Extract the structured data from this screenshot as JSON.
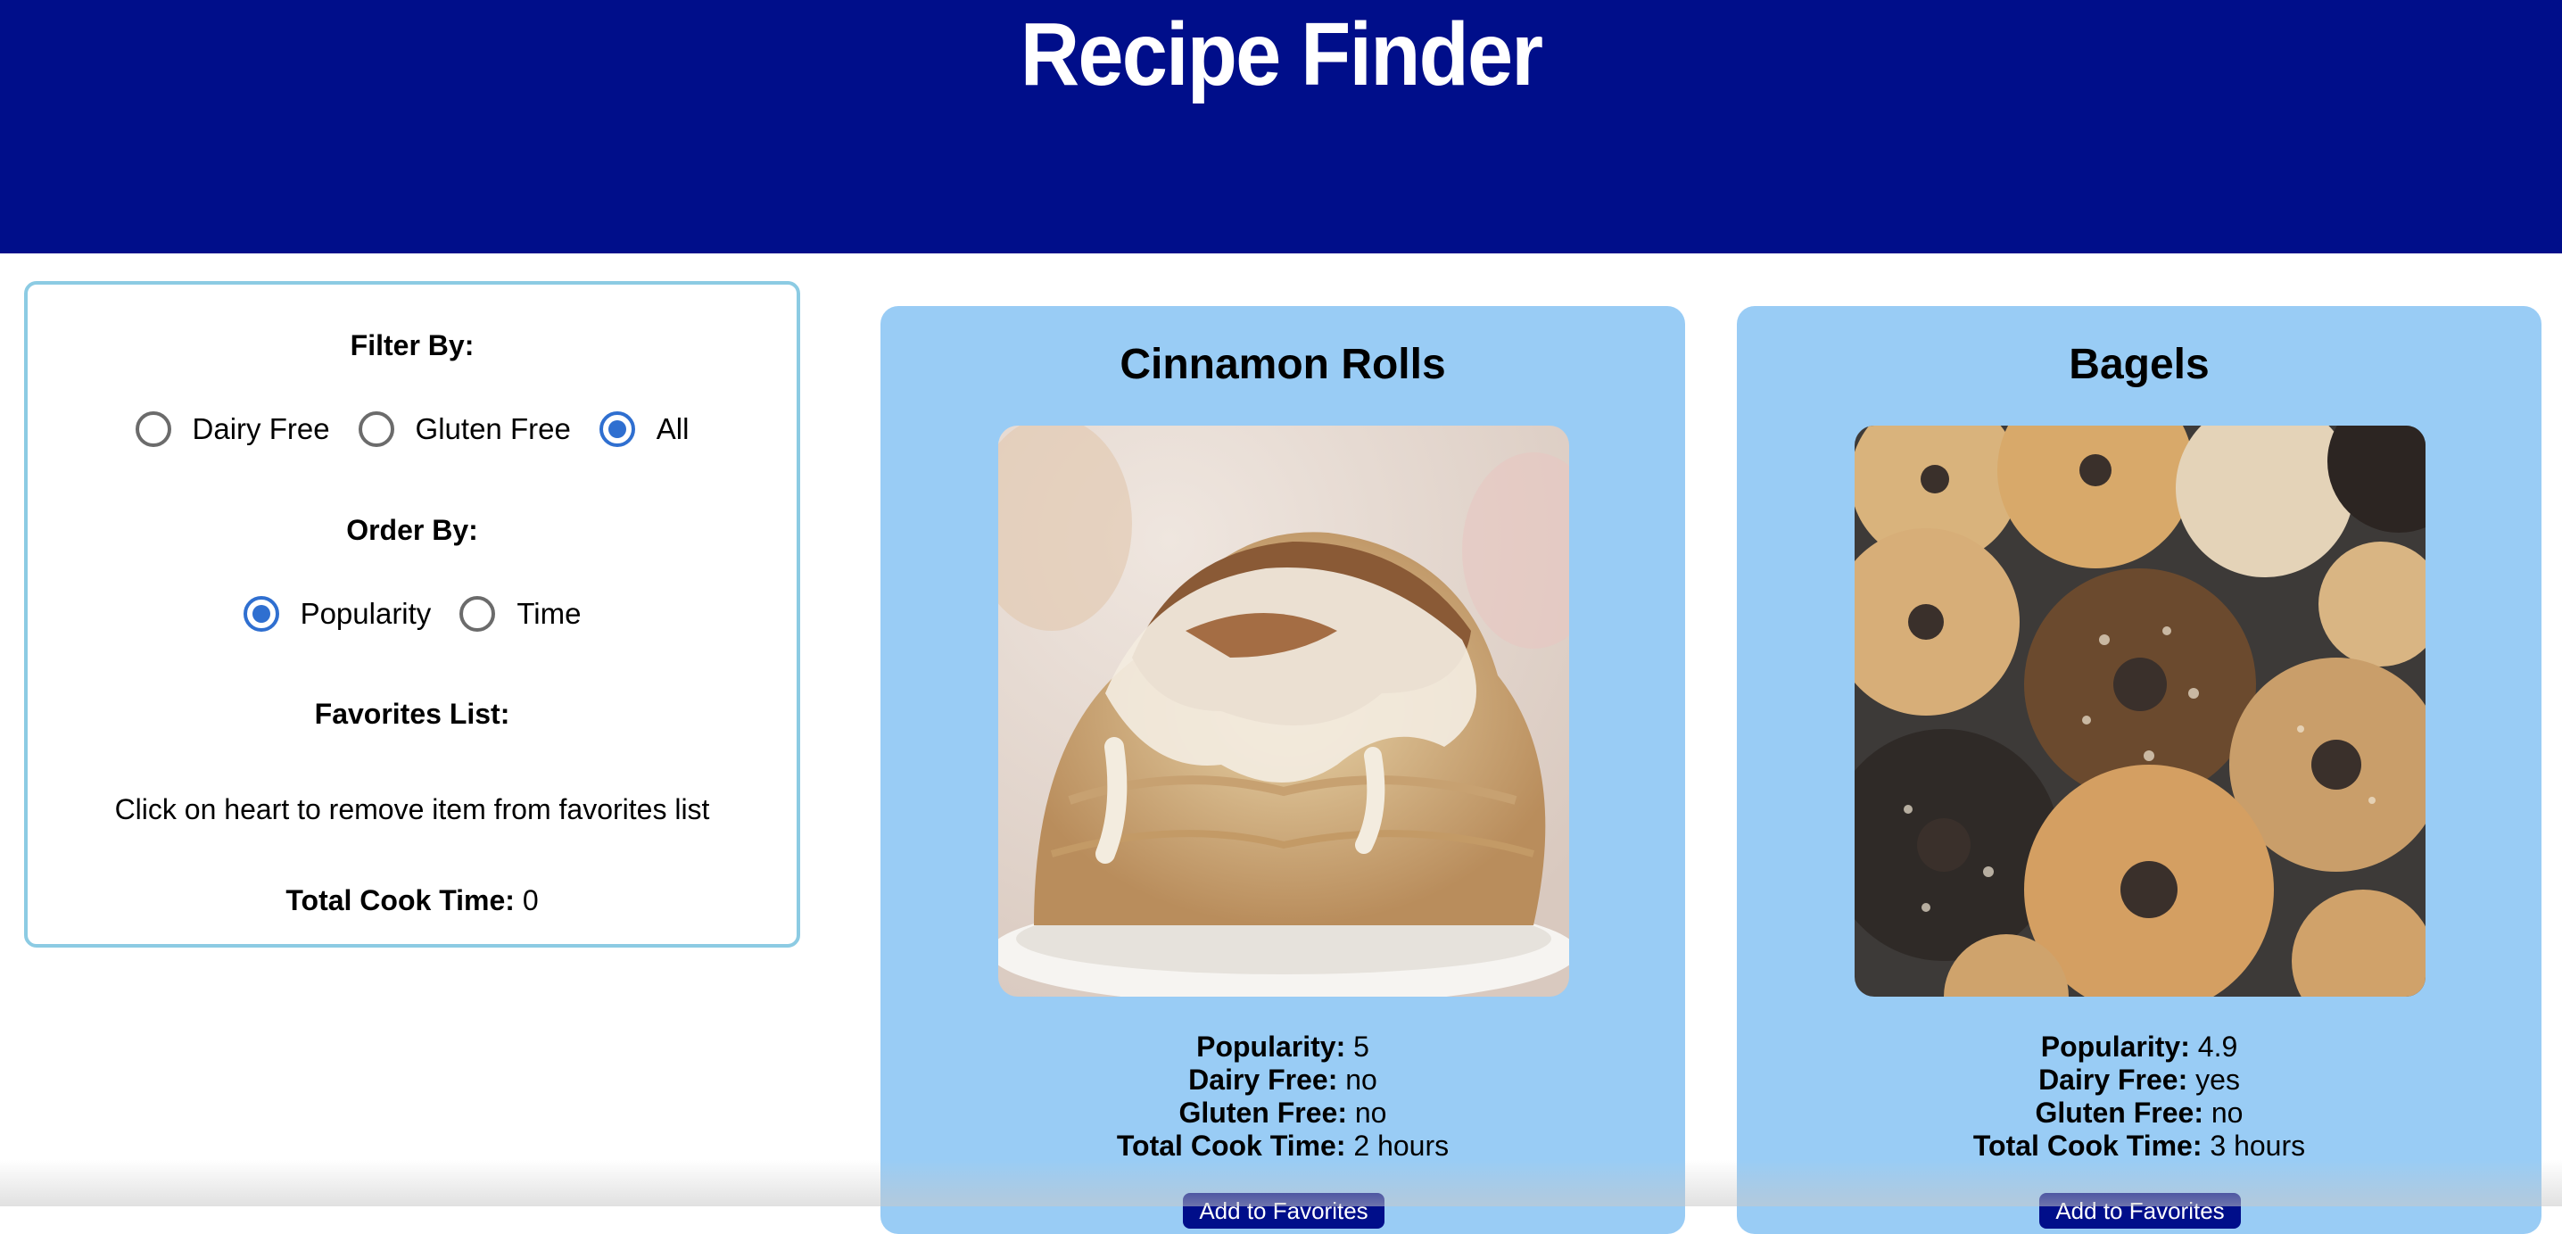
{
  "header": {
    "title": "Recipe Finder"
  },
  "filters": {
    "filter_heading": "Filter By:",
    "filter_options": [
      {
        "label": "Dairy Free",
        "checked": false
      },
      {
        "label": "Gluten Free",
        "checked": false
      },
      {
        "label": "All",
        "checked": true
      }
    ],
    "order_heading": "Order By:",
    "order_options": [
      {
        "label": "Popularity",
        "checked": true
      },
      {
        "label": "Time",
        "checked": false
      }
    ],
    "favorites_heading": "Favorites List:",
    "favorites_note": "Click on heart to remove item from favorites list",
    "total_label": "Total Cook Time:",
    "total_value": "0"
  },
  "recipes": [
    {
      "name": "Cinnamon Rolls",
      "popularity_label": "Popularity:",
      "popularity": "5",
      "dairy_label": "Dairy Free:",
      "dairy_free": "no",
      "gluten_label": "Gluten Free:",
      "gluten_free": "no",
      "time_label": "Total Cook Time:",
      "cook_time": "2 hours",
      "button": "Add to Favorites"
    },
    {
      "name": "Bagels",
      "popularity_label": "Popularity:",
      "popularity": "4.9",
      "dairy_label": "Dairy Free:",
      "dairy_free": "yes",
      "gluten_label": "Gluten Free:",
      "gluten_free": "no",
      "time_label": "Total Cook Time:",
      "cook_time": "3 hours",
      "button": "Add to Favorites"
    }
  ],
  "colors": {
    "header_bg": "#000e8a",
    "card_bg": "#99ccf5",
    "panel_border": "#8ccbe3",
    "radio_checked": "#2f6fd0"
  }
}
